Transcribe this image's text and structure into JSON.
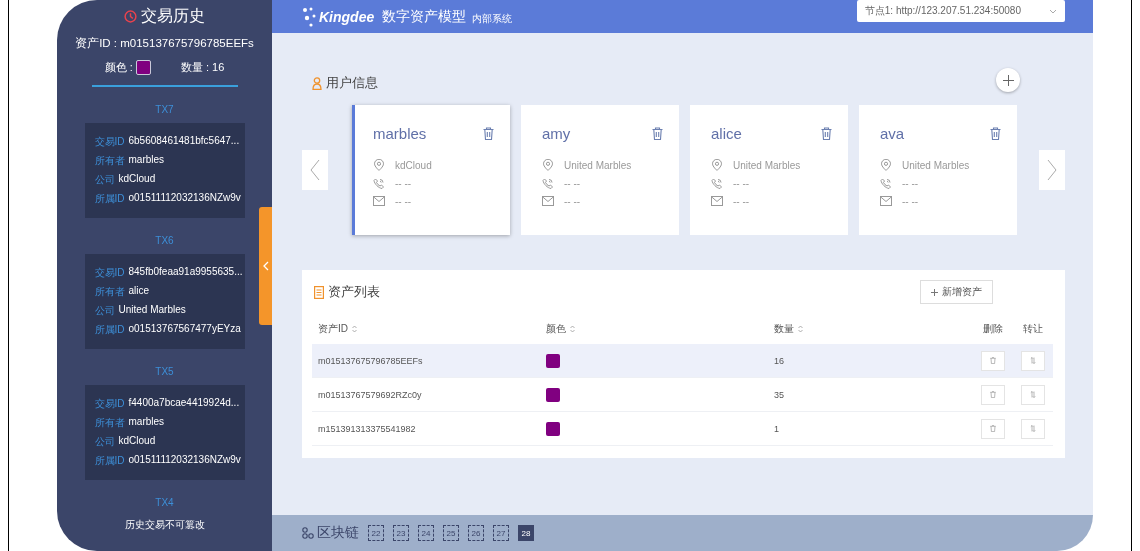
{
  "sidebar": {
    "title": "交易历史",
    "asset_id": "资产ID : m015137675796785EEFs",
    "color_label": "颜色 :",
    "color": "#800080",
    "quantity": "数量 : 16",
    "transactions": [
      {
        "label": "TX7",
        "fields": [
          {
            "key": "交易ID",
            "value": "6b5608461481bfc5647..."
          },
          {
            "key": "所有者",
            "value": "marbles"
          },
          {
            "key": "公司",
            "value": "kdCloud"
          },
          {
            "key": "所属ID",
            "value": "o01511112032136NZw9v"
          }
        ]
      },
      {
        "label": "TX6",
        "fields": [
          {
            "key": "交易ID",
            "value": "845fb0feaa91a9955635..."
          },
          {
            "key": "所有者",
            "value": "alice"
          },
          {
            "key": "公司",
            "value": "United Marbles"
          },
          {
            "key": "所属ID",
            "value": "o01513767567477yEYza"
          }
        ]
      },
      {
        "label": "TX5",
        "fields": [
          {
            "key": "交易ID",
            "value": "f4400a7bcae4419924d..."
          },
          {
            "key": "所有者",
            "value": "marbles"
          },
          {
            "key": "公司",
            "value": "kdCloud"
          },
          {
            "key": "所属ID",
            "value": "o01511112032136NZw9v"
          }
        ]
      },
      {
        "label": "TX4"
      }
    ],
    "note": "历史交易不可篡改"
  },
  "header": {
    "logo": "Kingdee",
    "title": "数字资产模型",
    "subtitle": "内部系统",
    "node": "节点1: http://123.207.51.234:50080"
  },
  "users": {
    "title": "用户信息",
    "cards": [
      {
        "name": "marbles",
        "company": "kdCloud",
        "phone": "-- --",
        "email": "-- --",
        "selected": true
      },
      {
        "name": "amy",
        "company": "United Marbles",
        "phone": "-- --",
        "email": "-- --",
        "selected": false
      },
      {
        "name": "alice",
        "company": "United Marbles",
        "phone": "-- --",
        "email": "-- --",
        "selected": false
      },
      {
        "name": "ava",
        "company": "United Marbles",
        "phone": "-- --",
        "email": "-- --",
        "selected": false
      }
    ]
  },
  "assets": {
    "title": "资产列表",
    "add_button": "新增资产",
    "columns": [
      {
        "label": "资产ID",
        "sortable": true
      },
      {
        "label": "颜色",
        "sortable": true
      },
      {
        "label": "数量",
        "sortable": true
      },
      {
        "label": "删除",
        "sortable": false
      },
      {
        "label": "转让",
        "sortable": false
      }
    ],
    "rows": [
      {
        "id": "m015137675796785EEFs",
        "color": "#800080",
        "quantity": "16",
        "selected": true
      },
      {
        "id": "m01513767579692RZc0y",
        "color": "#800080",
        "quantity": "35",
        "selected": false
      },
      {
        "id": "m151391313375541982",
        "color": "#800080",
        "quantity": "1",
        "selected": false
      }
    ]
  },
  "blockchain": {
    "label": "区块链",
    "blocks": [
      {
        "number": "22",
        "selected": false
      },
      {
        "number": "23",
        "selected": false
      },
      {
        "number": "24",
        "selected": false
      },
      {
        "number": "25",
        "selected": false
      },
      {
        "number": "26",
        "selected": false
      },
      {
        "number": "27",
        "selected": false
      },
      {
        "number": "28",
        "selected": true
      }
    ]
  }
}
